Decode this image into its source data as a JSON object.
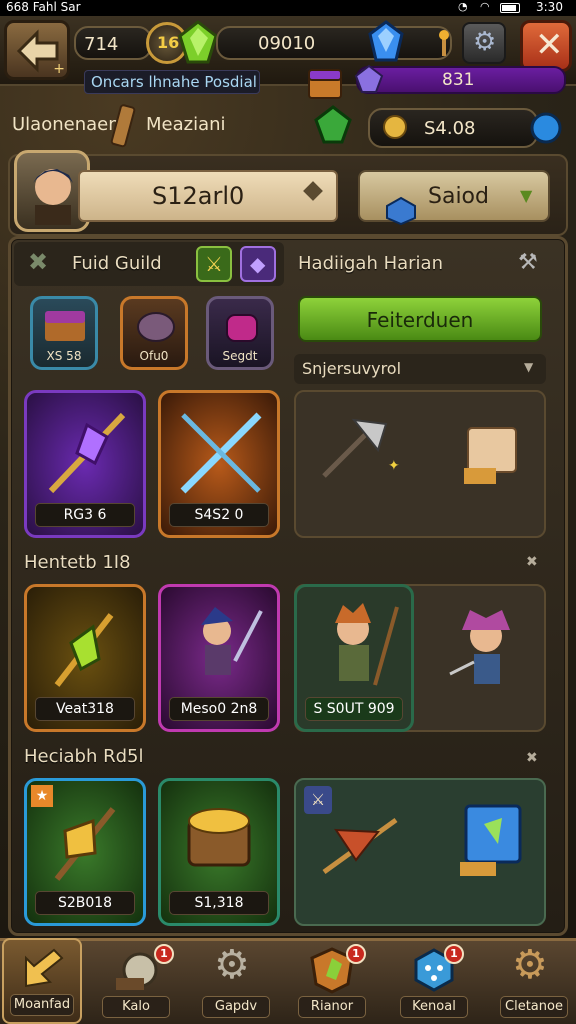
{
  "status_bar": {
    "left_text": "668 Fahl Sar",
    "time": "3:30"
  },
  "top_bar": {
    "level_value": "714",
    "gem_level": "16",
    "currency_value": "09010"
  },
  "sub_bar": {
    "banner_text": "Oncars lhnahe Posdial",
    "bar_value": "831",
    "gold_value": "S4.08"
  },
  "labels": {
    "left_label": "Ulaonenaen",
    "right_label": "Meaziani"
  },
  "player": {
    "name_value": "S12arl0",
    "side_button": "Saiod"
  },
  "guild": {
    "title": "Fuid Guild",
    "items": [
      {
        "label": "XS 58"
      },
      {
        "label": "Ofu0"
      },
      {
        "label": "Segdt"
      }
    ]
  },
  "daily": {
    "title": "Hadiigah Harian",
    "button": "Feiterduen",
    "subheader": "Snjersuvyrol"
  },
  "row1": {
    "cards": [
      {
        "label": "RG3 6"
      },
      {
        "label": "S4S2 0"
      }
    ]
  },
  "section2": {
    "title": "Hentetb 1I8",
    "cards": [
      {
        "label": "Veat318"
      },
      {
        "label": "Meso0 2n8"
      },
      {
        "label": "S S0UT 909"
      }
    ]
  },
  "section3": {
    "title": "Heciabh Rd5l",
    "cards": [
      {
        "label": "S2B018"
      },
      {
        "label": "S1,318"
      }
    ]
  },
  "nav": {
    "items": [
      {
        "label": "Moanfad",
        "badge": ""
      },
      {
        "label": "Kalo",
        "badge": "1"
      },
      {
        "label": "Gapdv",
        "badge": ""
      },
      {
        "label": "Rianor",
        "badge": "1"
      },
      {
        "label": "Kenoal",
        "badge": "1"
      },
      {
        "label": "Cletanoe",
        "badge": ""
      }
    ]
  },
  "colors": {
    "accent_green": "#5a9a1e",
    "accent_purple": "#8a2bd0",
    "close_red": "#c84a2a",
    "gold": "#e5b640"
  }
}
